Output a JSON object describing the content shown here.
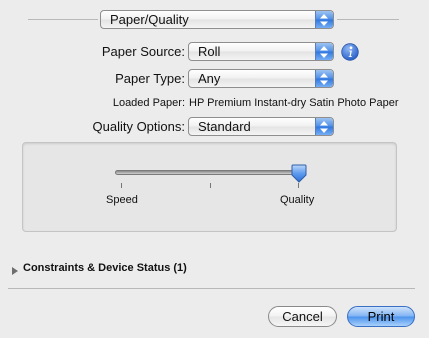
{
  "panel_popup": {
    "label": "Paper/Quality"
  },
  "paper_source": {
    "label": "Paper Source:",
    "value": "Roll"
  },
  "paper_type": {
    "label": "Paper Type:",
    "value": "Any"
  },
  "loaded_paper": {
    "label": "Loaded Paper:",
    "value": "HP Premium Instant-dry Satin Photo Paper"
  },
  "quality_options": {
    "label": "Quality Options:",
    "value": "Standard"
  },
  "slider": {
    "min_label": "Speed",
    "max_label": "Quality",
    "ticks": 3,
    "level": 1.0
  },
  "constraints": {
    "label": "Constraints & Device Status (1)",
    "expanded": false
  },
  "buttons": {
    "cancel": "Cancel",
    "print": "Print"
  },
  "colors": {
    "info_icon": "#3b6fd4",
    "accent": "#4a92ec"
  }
}
